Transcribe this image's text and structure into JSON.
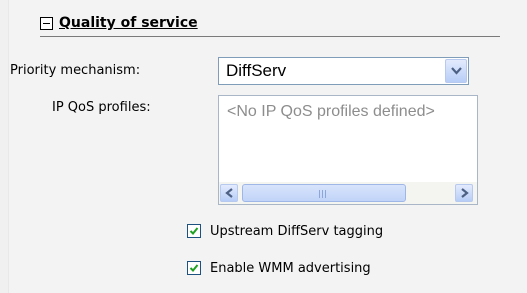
{
  "section": {
    "title": "Quality of service",
    "collapse_icon": "minus-box-icon"
  },
  "priority": {
    "label": "Priority mechanism:",
    "selected": "DiffServ"
  },
  "profiles": {
    "label": "IP QoS profiles:",
    "placeholder": "<No IP QoS profiles defined>"
  },
  "checkboxes": [
    {
      "label": "Upstream DiffServ tagging",
      "checked": true
    },
    {
      "label": "Enable WMM advertising",
      "checked": true
    }
  ]
}
